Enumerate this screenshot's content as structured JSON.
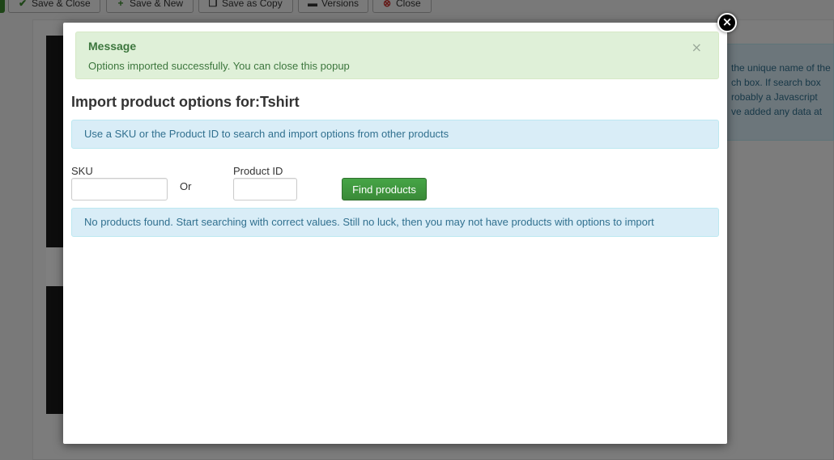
{
  "toolbar": {
    "buttons": [
      {
        "label": "Save & Close",
        "icon": "check-icon"
      },
      {
        "label": "Save & New",
        "icon": "plus-icon"
      },
      {
        "label": "Save as Copy",
        "icon": "copy-icon"
      },
      {
        "label": "Versions",
        "icon": "versions-icon"
      },
      {
        "label": "Close",
        "icon": "close-circle-icon"
      }
    ]
  },
  "background_info": {
    "lines": [
      "the unique name of the",
      "ch box. If search box",
      "robably a Javascript",
      "ve added any data at"
    ]
  },
  "modal": {
    "close_glyph": "×",
    "message": {
      "heading": "Message",
      "body": "Options imported successfully. You can close this popup",
      "dismiss_glyph": "×"
    },
    "title": "Import product options for:Tshirt",
    "search_hint": "Use a SKU or the Product ID to search and import options from other products",
    "sku_label": "SKU",
    "sku_value": "",
    "or_text": "Or",
    "product_id_label": "Product ID",
    "product_id_value": "",
    "find_button": "Find products",
    "no_results": "No products found. Start searching with correct values. Still no luck, then you may not have products with options to import"
  },
  "colors": {
    "success_bg": "#dff0d8",
    "success_text": "#3c763d",
    "info_bg": "#d9edf7",
    "info_text": "#31708f",
    "button_green": "#46a546"
  }
}
